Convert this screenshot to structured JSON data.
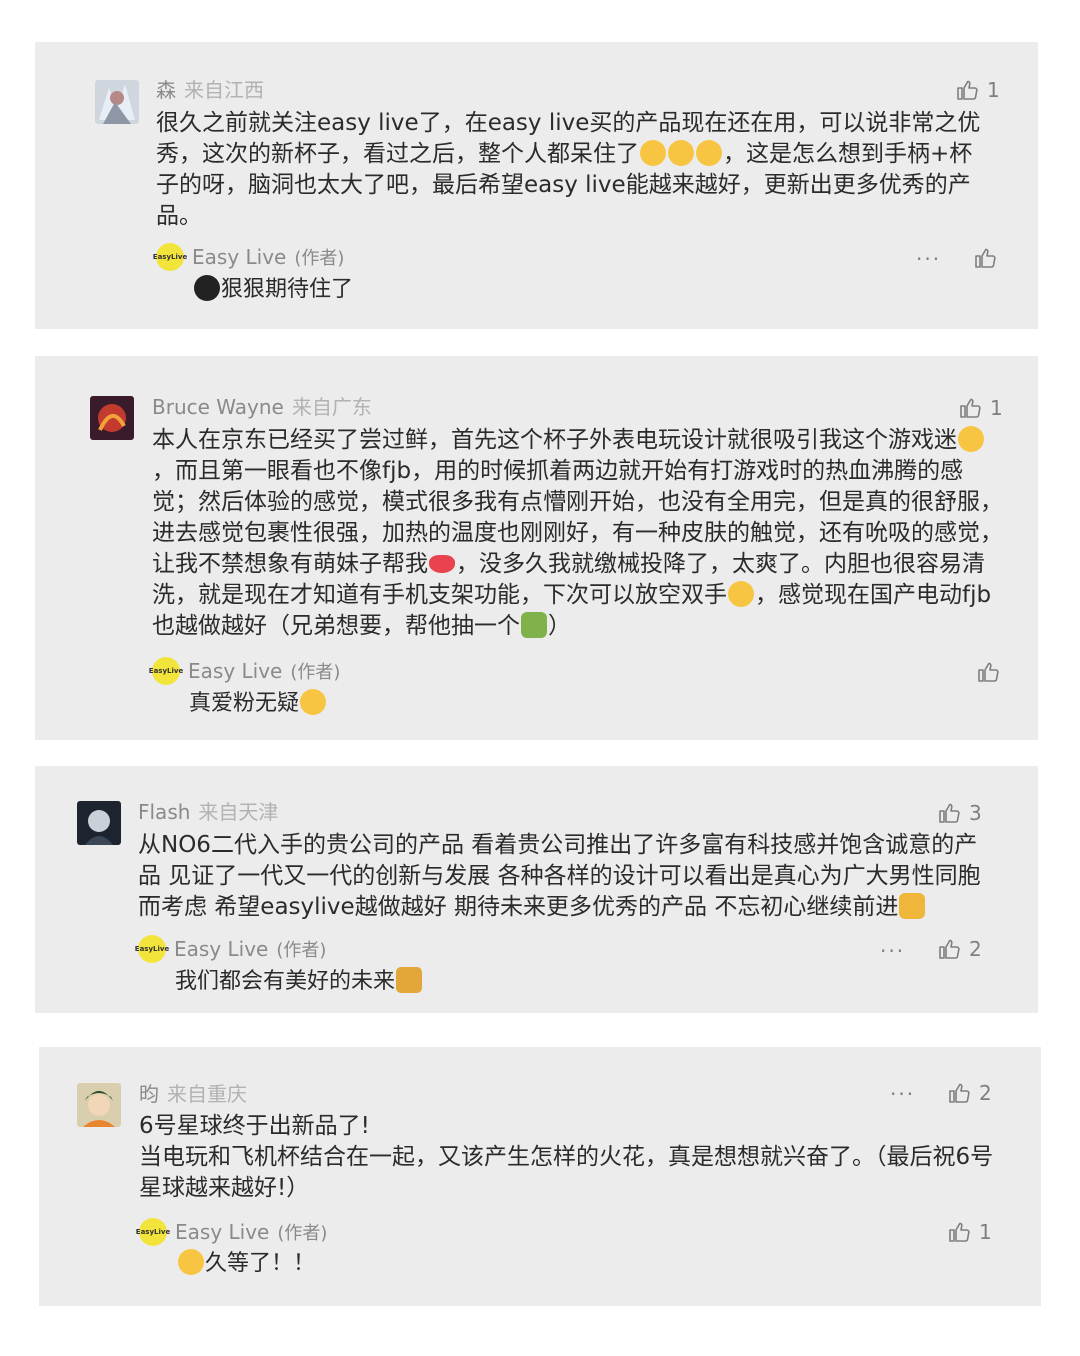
{
  "comments": [
    {
      "user": "森",
      "location": "来自江西",
      "likes": "1",
      "text": "很久之前就关注easy live了，在easy live买的产品现在还在用，可以说非常之优秀，这次的新杯子，看过之后，整个人都呆住了",
      "text_tail": "，这是怎么想到手柄+杯子的呀，脑洞也太大了吧，最后希望easy live能越来越好，更新出更多优秀的产品。",
      "reply": {
        "author": "Easy Live",
        "tag": "(作者)",
        "more": "···",
        "text": "狠狠期待住了"
      }
    },
    {
      "user": "Bruce Wayne",
      "location": "来自广东",
      "likes": "1",
      "text_1": "本人在京东已经买了尝过鲜，首先这个杯子外表电玩设计就很吸引我这个游戏迷",
      "text_2": "，而且第一眼看也不像fjb，用的时候抓着两边就开始有打游戏时的热血沸腾的感觉；然后体验的感觉，模式很多我有点懵刚开始，也没有全用完，但是真的很舒服，进去感觉包裹性很强，加热的温度也刚刚好，有一种皮肤的触觉，还有吮吸的感觉，让我不禁想象有萌妹子帮我",
      "text_3": "，没多久我就缴械投降了，太爽了。内胆也很容易清洗，就是现在才知道有手机支架功能，下次可以放空双手",
      "text_4": "，感觉现在国产电动fjb也越做越好（兄弟想要，帮他抽一个",
      "text_5": "）",
      "reply": {
        "author": "Easy Live",
        "tag": "(作者)",
        "text": "真爱粉无疑"
      }
    },
    {
      "user": "Flash",
      "location": "来自天津",
      "likes": "3",
      "text": "从NO6二代入手的贵公司的产品 看着贵公司推出了许多富有科技感并饱含诚意的产品 见证了一代又一代的创新与发展 各种各样的设计可以看出是真心为广大男性同胞而考虑 希望easylive越做越好 期待未来更多优秀的产品 不忘初心继续前进",
      "reply": {
        "author": "Easy Live",
        "tag": "(作者)",
        "more": "···",
        "likes": "2",
        "text": "我们都会有美好的未来"
      }
    },
    {
      "user": "昀",
      "location": "来自重庆",
      "more": "···",
      "likes": "2",
      "text_line1": "6号星球终于出新品了!",
      "text_line2": "当电玩和飞机杯结合在一起，又该产生怎样的火花，真是想想就兴奋了。（最后祝6号星球越来越好!）",
      "reply": {
        "author": "Easy Live",
        "tag": "(作者)",
        "likes": "1",
        "text": "久等了！！"
      }
    }
  ],
  "logo_text": "EasyLive",
  "colors": {
    "card_bg": "#ececec",
    "name": "#8a8a8a",
    "location": "#b2b2b2",
    "text": "#2b2b2b",
    "logo": "#f2e43a"
  },
  "icons": [
    "thumb-up-icon",
    "more-icon",
    "avatar",
    "easy-live-logo",
    "emoji"
  ]
}
